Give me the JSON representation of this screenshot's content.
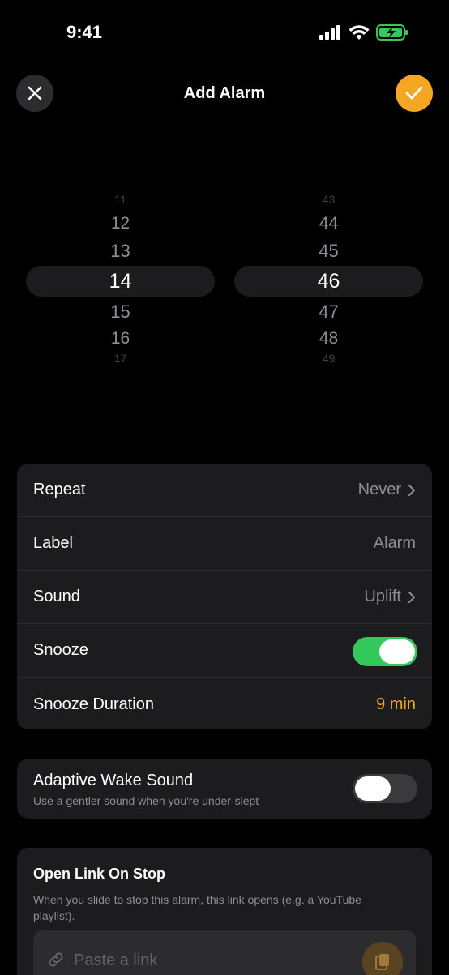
{
  "status_bar": {
    "time": "9:41"
  },
  "header": {
    "title": "Add Alarm"
  },
  "picker": {
    "hours": [
      "11",
      "12",
      "13",
      "14",
      "15",
      "16",
      "17"
    ],
    "minutes": [
      "43",
      "44",
      "45",
      "46",
      "47",
      "48",
      "49"
    ],
    "selected_hour": "14",
    "selected_minute": "46"
  },
  "settings": {
    "repeat": {
      "label": "Repeat",
      "value": "Never"
    },
    "label": {
      "label": "Label",
      "value": "Alarm"
    },
    "sound": {
      "label": "Sound",
      "value": "Uplift"
    },
    "snooze": {
      "label": "Snooze",
      "on": true
    },
    "snooze_duration": {
      "label": "Snooze Duration",
      "value": "9 min"
    }
  },
  "adaptive": {
    "title": "Adaptive Wake Sound",
    "subtitle": "Use a gentler sound when you're under-slept",
    "on": false
  },
  "link": {
    "title": "Open Link On Stop",
    "subtitle": "When you slide to stop this alarm, this link opens (e.g. a YouTube playlist).",
    "placeholder": "Paste a link"
  },
  "colors": {
    "accent": "#f5a623",
    "toggle_on": "#34c759",
    "card_bg": "#1c1c1e"
  }
}
